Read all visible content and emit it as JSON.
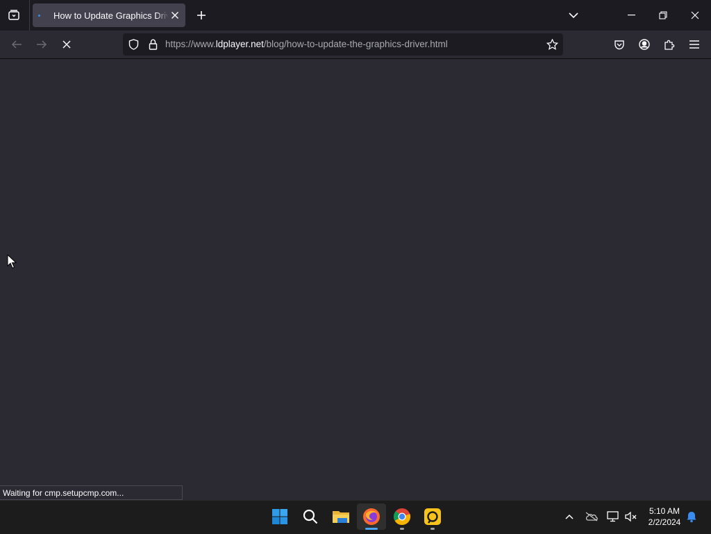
{
  "browser": {
    "tab": {
      "title": "How to Update Graphics Driver"
    },
    "url": {
      "prefix": "https://www.",
      "host": "ldplayer.net",
      "path": "/blog/how-to-update-the-graphics-driver.html"
    },
    "status_text": "Waiting for cmp.setupcmp.com...",
    "icons": {
      "tab_manager": "tab-manager-icon",
      "new_tab": "plus-icon",
      "list_all_tabs": "chevron-down-icon",
      "back": "back-arrow-icon",
      "forward": "forward-arrow-icon",
      "stop": "stop-icon",
      "tracking_protection": "shield-icon",
      "connection": "lock-icon",
      "bookmark": "star-icon",
      "pocket": "pocket-icon",
      "account": "account-icon",
      "extensions": "puzzle-icon",
      "menu": "hamburger-menu-icon"
    }
  },
  "window_controls": {
    "minimize": "minimize-icon",
    "restore": "restore-icon",
    "close": "close-icon"
  },
  "taskbar": {
    "apps": [
      "windows-start-icon",
      "search-icon",
      "file-explorer-icon",
      "firefox-icon",
      "chrome-icon",
      "ldplayer-icon"
    ],
    "tray": [
      "chevron-up-icon",
      "onedrive-offline-icon",
      "network-icon",
      "volume-muted-icon",
      "notification-bell-icon"
    ],
    "time": "5:10 AM",
    "date": "2/2/2024"
  },
  "colors": {
    "titlebar": "#1c1b22",
    "toolbar": "#2b2a33",
    "active_tab": "#42414d",
    "urlbar": "#1c1b22",
    "taskbar": "#1c1c1c",
    "accent": "#3a8df0"
  }
}
